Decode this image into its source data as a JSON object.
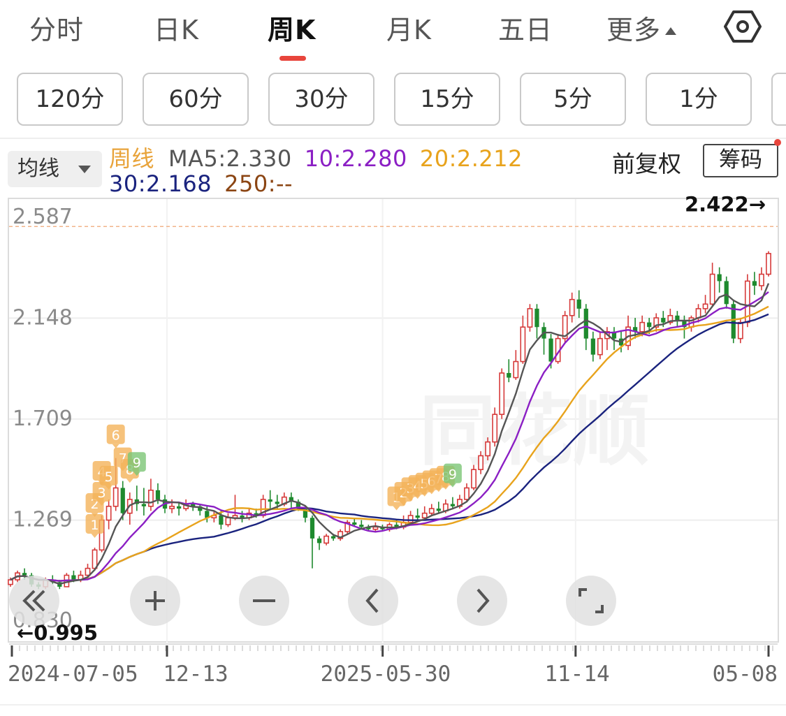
{
  "tabs": [
    {
      "label": "分时",
      "active": false
    },
    {
      "label": "日K",
      "active": false
    },
    {
      "label": "周K",
      "active": true
    },
    {
      "label": "月K",
      "active": false
    },
    {
      "label": "五日",
      "active": false
    },
    {
      "label": "更多",
      "active": false
    }
  ],
  "settings_icon": "hexagon-settings-icon",
  "periods": [
    "120分",
    "60分",
    "30分",
    "15分",
    "5分",
    "1分"
  ],
  "ma_select_label": "均线",
  "legend": {
    "prefix": "周线",
    "ma5": "MA5:2.330",
    "ma10": "10:2.280",
    "ma20": "20:2.212",
    "ma30": "30:2.168",
    "ma250": "250:--"
  },
  "colors": {
    "prefix": "#e8a33a",
    "ma5": "#555555",
    "ma10": "#8b1fc4",
    "ma20": "#e8a31c",
    "ma30": "#1a237e",
    "ma250": "#8b4513",
    "up": "#d63a3a",
    "down": "#1e8a2e",
    "signal_sell": "#f4b35a",
    "signal_buy": "#7cc576"
  },
  "fuquan_label": "前复权",
  "chouma_label": "筹码",
  "watermark": "同花顺",
  "chart_data": {
    "type": "candlestick",
    "period": "weekly",
    "y_ticks": [
      "2.587",
      "2.148",
      "1.709",
      "1.269",
      "0.830"
    ],
    "ylim": [
      0.83,
      2.587
    ],
    "x_ticks": [
      "2024-07-05",
      "12-13",
      "2025-05-30",
      "11-14",
      "05-08"
    ],
    "highest_label": "2.422→",
    "highest": 2.422,
    "lowest_label": "←0.995",
    "lowest": 0.995,
    "ma_last": {
      "ma5": 2.33,
      "ma10": 2.28,
      "ma20": 2.212,
      "ma30": 2.168
    },
    "candles": [
      [
        0.98,
        1.0,
        1.01,
        0.97
      ],
      [
        1.0,
        1.03,
        1.04,
        0.99
      ],
      [
        1.03,
        1.02,
        1.05,
        1.0
      ],
      [
        1.02,
        0.98,
        1.03,
        0.97
      ],
      [
        0.98,
        0.97,
        0.99,
        0.96
      ],
      [
        0.97,
        1.0,
        1.01,
        0.96
      ],
      [
        1.0,
        0.99,
        1.02,
        0.98
      ],
      [
        0.99,
        0.97,
        1.0,
        0.96
      ],
      [
        0.97,
        1.02,
        1.03,
        0.97
      ],
      [
        1.02,
        1.0,
        1.04,
        0.99
      ],
      [
        1.0,
        1.02,
        1.04,
        0.99
      ],
      [
        1.02,
        1.05,
        1.07,
        1.01
      ],
      [
        1.05,
        1.13,
        1.14,
        1.04
      ],
      [
        1.13,
        1.26,
        1.28,
        1.12
      ],
      [
        1.26,
        1.32,
        1.35,
        1.22
      ],
      [
        1.32,
        1.4,
        1.53,
        1.3
      ],
      [
        1.4,
        1.29,
        1.43,
        1.26
      ],
      [
        1.29,
        1.35,
        1.38,
        1.24
      ],
      [
        1.35,
        1.33,
        1.41,
        1.3
      ],
      [
        1.33,
        1.32,
        1.4,
        1.28
      ],
      [
        1.32,
        1.39,
        1.44,
        1.3
      ],
      [
        1.39,
        1.35,
        1.42,
        1.33
      ],
      [
        1.35,
        1.31,
        1.37,
        1.29
      ],
      [
        1.31,
        1.32,
        1.35,
        1.29
      ],
      [
        1.32,
        1.31,
        1.34,
        1.28
      ],
      [
        1.31,
        1.33,
        1.35,
        1.3
      ],
      [
        1.33,
        1.32,
        1.34,
        1.3
      ],
      [
        1.32,
        1.3,
        1.33,
        1.28
      ],
      [
        1.3,
        1.27,
        1.32,
        1.25
      ],
      [
        1.27,
        1.28,
        1.3,
        1.25
      ],
      [
        1.28,
        1.24,
        1.3,
        1.22
      ],
      [
        1.24,
        1.27,
        1.29,
        1.23
      ],
      [
        1.27,
        1.28,
        1.37,
        1.26
      ],
      [
        1.28,
        1.27,
        1.3,
        1.25
      ],
      [
        1.27,
        1.29,
        1.31,
        1.26
      ],
      [
        1.29,
        1.28,
        1.31,
        1.27
      ],
      [
        1.28,
        1.35,
        1.37,
        1.27
      ],
      [
        1.35,
        1.34,
        1.39,
        1.31
      ],
      [
        1.34,
        1.33,
        1.37,
        1.31
      ],
      [
        1.33,
        1.36,
        1.38,
        1.32
      ],
      [
        1.36,
        1.34,
        1.38,
        1.31
      ],
      [
        1.34,
        1.31,
        1.35,
        1.3
      ],
      [
        1.31,
        1.27,
        1.32,
        1.25
      ],
      [
        1.27,
        1.18,
        1.28,
        1.05
      ],
      [
        1.18,
        1.16,
        1.19,
        1.13
      ],
      [
        1.16,
        1.19,
        1.2,
        1.15
      ],
      [
        1.19,
        1.18,
        1.2,
        1.17
      ],
      [
        1.18,
        1.21,
        1.22,
        1.17
      ],
      [
        1.21,
        1.25,
        1.26,
        1.2
      ],
      [
        1.25,
        1.24,
        1.27,
        1.23
      ],
      [
        1.24,
        1.23,
        1.26,
        1.22
      ],
      [
        1.23,
        1.22,
        1.24,
        1.21
      ],
      [
        1.22,
        1.23,
        1.25,
        1.21
      ],
      [
        1.23,
        1.22,
        1.24,
        1.21
      ],
      [
        1.22,
        1.24,
        1.25,
        1.21
      ],
      [
        1.24,
        1.23,
        1.26,
        1.22
      ],
      [
        1.23,
        1.25,
        1.28,
        1.22
      ],
      [
        1.25,
        1.28,
        1.3,
        1.24
      ],
      [
        1.28,
        1.27,
        1.31,
        1.26
      ],
      [
        1.27,
        1.29,
        1.32,
        1.26
      ],
      [
        1.29,
        1.31,
        1.33,
        1.28
      ],
      [
        1.31,
        1.3,
        1.34,
        1.29
      ],
      [
        1.3,
        1.33,
        1.35,
        1.29
      ],
      [
        1.33,
        1.32,
        1.36,
        1.31
      ],
      [
        1.32,
        1.35,
        1.37,
        1.31
      ],
      [
        1.35,
        1.4,
        1.42,
        1.34
      ],
      [
        1.4,
        1.48,
        1.5,
        1.39
      ],
      [
        1.48,
        1.54,
        1.56,
        1.46
      ],
      [
        1.54,
        1.6,
        1.62,
        1.52
      ],
      [
        1.6,
        1.72,
        1.75,
        1.58
      ],
      [
        1.72,
        1.9,
        1.92,
        1.7
      ],
      [
        1.9,
        1.88,
        1.96,
        1.86
      ],
      [
        1.88,
        1.95,
        2.0,
        1.87
      ],
      [
        1.95,
        2.1,
        2.15,
        1.94
      ],
      [
        2.1,
        2.18,
        2.2,
        2.08
      ],
      [
        2.18,
        2.1,
        2.2,
        2.05
      ],
      [
        2.1,
        2.05,
        2.12,
        1.98
      ],
      [
        2.05,
        1.95,
        2.07,
        1.92
      ],
      [
        1.95,
        2.05,
        2.07,
        1.94
      ],
      [
        2.05,
        2.15,
        2.17,
        2.03
      ],
      [
        2.15,
        2.22,
        2.25,
        2.12
      ],
      [
        2.22,
        2.18,
        2.26,
        2.14
      ],
      [
        2.18,
        2.05,
        2.2,
        2.0
      ],
      [
        2.05,
        1.98,
        2.08,
        1.95
      ],
      [
        1.98,
        2.05,
        2.08,
        1.96
      ],
      [
        2.05,
        2.08,
        2.1,
        2.0
      ],
      [
        2.08,
        2.05,
        2.1,
        2.0
      ],
      [
        2.05,
        2.02,
        2.08,
        1.99
      ],
      [
        2.02,
        2.1,
        2.15,
        2.0
      ],
      [
        2.1,
        2.08,
        2.14,
        2.05
      ],
      [
        2.08,
        2.12,
        2.15,
        2.06
      ],
      [
        2.12,
        2.1,
        2.14,
        2.07
      ],
      [
        2.1,
        2.14,
        2.16,
        2.08
      ],
      [
        2.14,
        2.12,
        2.17,
        2.1
      ],
      [
        2.12,
        2.15,
        2.18,
        2.11
      ],
      [
        2.15,
        2.13,
        2.17,
        2.1
      ],
      [
        2.13,
        2.1,
        2.15,
        2.05
      ],
      [
        2.1,
        2.14,
        2.15,
        2.08
      ],
      [
        2.14,
        2.18,
        2.2,
        2.12
      ],
      [
        2.18,
        2.2,
        2.24,
        2.16
      ],
      [
        2.2,
        2.33,
        2.38,
        2.19
      ],
      [
        2.33,
        2.3,
        2.36,
        2.25
      ],
      [
        2.3,
        2.2,
        2.32,
        2.18
      ],
      [
        2.2,
        2.05,
        2.22,
        2.03
      ],
      [
        2.05,
        2.12,
        2.14,
        2.03
      ],
      [
        2.12,
        2.3,
        2.33,
        2.1
      ],
      [
        2.3,
        2.28,
        2.34,
        2.24
      ],
      [
        2.28,
        2.33,
        2.36,
        2.26
      ],
      [
        2.33,
        2.42,
        2.43,
        2.32
      ]
    ],
    "signals": [
      {
        "i": 12,
        "label": "1",
        "kind": "sell"
      },
      {
        "i": 12,
        "label": "2",
        "kind": "sell"
      },
      {
        "i": 13,
        "label": "3",
        "kind": "sell"
      },
      {
        "i": 13,
        "label": "4",
        "kind": "sell"
      },
      {
        "i": 14,
        "label": "5",
        "kind": "sell"
      },
      {
        "i": 15,
        "label": "6",
        "kind": "sell"
      },
      {
        "i": 16,
        "label": "7",
        "kind": "sell"
      },
      {
        "i": 17,
        "label": "8",
        "kind": "sell"
      },
      {
        "i": 18,
        "label": "9",
        "kind": "buy"
      },
      {
        "i": 55,
        "label": "1",
        "kind": "sell"
      },
      {
        "i": 56,
        "label": "2",
        "kind": "sell"
      },
      {
        "i": 57,
        "label": "3",
        "kind": "sell"
      },
      {
        "i": 58,
        "label": "4",
        "kind": "sell"
      },
      {
        "i": 59,
        "label": "5",
        "kind": "sell"
      },
      {
        "i": 60,
        "label": "6",
        "kind": "sell"
      },
      {
        "i": 61,
        "label": "7",
        "kind": "sell"
      },
      {
        "i": 62,
        "label": "8",
        "kind": "sell"
      },
      {
        "i": 63,
        "label": "9",
        "kind": "buy"
      }
    ]
  },
  "controls": [
    {
      "name": "scroll-left-button",
      "icon": "double-chevron-left-icon"
    },
    {
      "name": "zoom-in-button",
      "icon": "plus-icon"
    },
    {
      "name": "zoom-out-button",
      "icon": "minus-icon"
    },
    {
      "name": "pan-left-button",
      "icon": "chevron-left-icon"
    },
    {
      "name": "pan-right-button",
      "icon": "chevron-right-icon"
    },
    {
      "name": "fullscreen-button",
      "icon": "expand-corners-icon"
    }
  ]
}
